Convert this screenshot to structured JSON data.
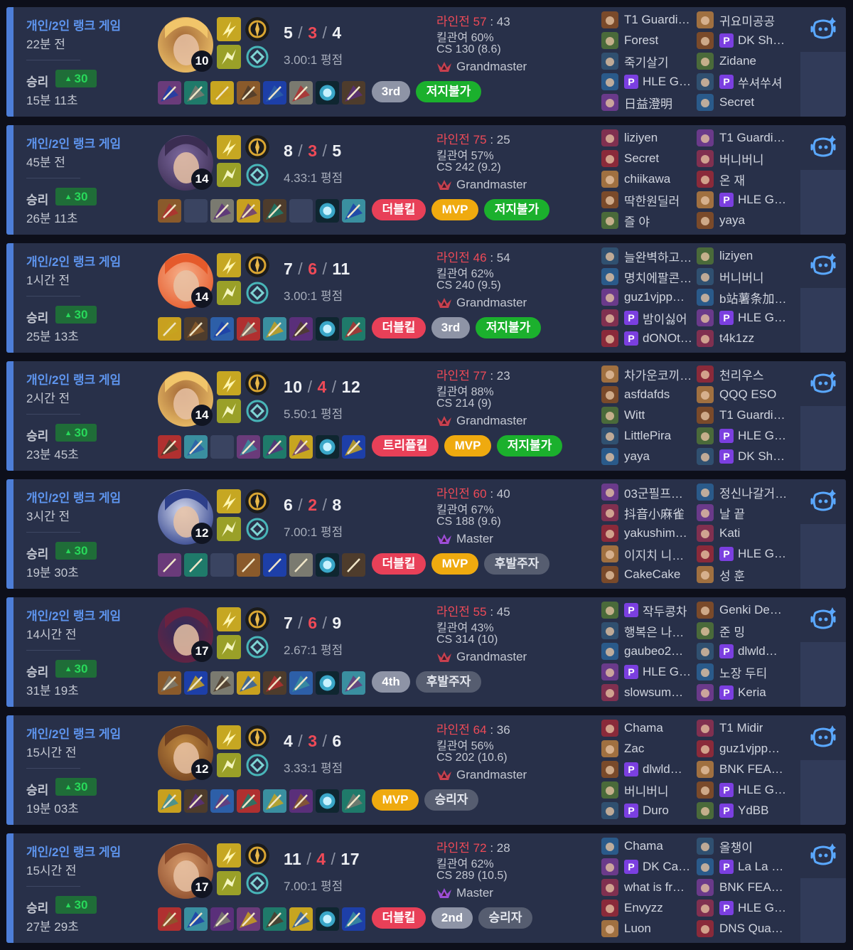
{
  "colors": {
    "card": "#283049",
    "accent": "#4d7ed8",
    "win_lp": "#28d85a",
    "red": "#ef4a57",
    "gold": "#efaa0f",
    "green": "#1bb02d"
  },
  "matches": [
    {
      "queue": "개인/2인 랭크 게임",
      "ago": "22분 전",
      "result": "승리",
      "lp": "30",
      "duration": "15분 11초",
      "level": "10",
      "champion_icon": "blonde-mage-champion-icon",
      "kda": {
        "k": "5",
        "d": "3",
        "a": "4"
      },
      "ratio": "3.00:1 평점",
      "lane": {
        "label": "라인전",
        "win": "57",
        "sep": ":",
        "loss": "43"
      },
      "kp": "킬관여 60%",
      "cs": "CS 130 (8.6)",
      "tier": "Grandmaster",
      "badges": [
        {
          "text": "3rd",
          "type": "gray"
        },
        {
          "text": "저지불가",
          "type": "green"
        }
      ],
      "items": [
        "item-1",
        "item-2",
        "item-3",
        "item-4",
        "item-5",
        "item-6",
        "item-7",
        "item-8"
      ],
      "team1": [
        {
          "name": "T1 Guardi…",
          "p": false
        },
        {
          "name": "Forest",
          "p": false
        },
        {
          "name": "죽기살기",
          "p": false
        },
        {
          "name": "HLE G…",
          "p": true
        },
        {
          "name": "日益澄明",
          "p": false
        }
      ],
      "team2": [
        {
          "name": "귀요미공공",
          "p": false
        },
        {
          "name": "DK Sh…",
          "p": true
        },
        {
          "name": "Zidane",
          "p": false
        },
        {
          "name": "쑤셔쑤셔",
          "p": true
        },
        {
          "name": "Secret",
          "p": false
        }
      ]
    },
    {
      "queue": "개인/2인 랭크 게임",
      "ago": "45분 전",
      "result": "승리",
      "lp": "30",
      "duration": "26분 11초",
      "level": "14",
      "champion_icon": "dark-hair-champion-icon",
      "kda": {
        "k": "8",
        "d": "3",
        "a": "5"
      },
      "ratio": "4.33:1 평점",
      "lane": {
        "label": "라인전",
        "win": "75",
        "sep": ":",
        "loss": "25"
      },
      "kp": "킬관여 57%",
      "cs": "CS 242 (9.2)",
      "tier": "Grandmaster",
      "badges": [
        {
          "text": "더블킬",
          "type": "red"
        },
        {
          "text": "MVP",
          "type": "gold"
        },
        {
          "text": "저지불가",
          "type": "green"
        }
      ],
      "items": [
        "item-1",
        "empty",
        "item-3",
        "item-4",
        "item-5",
        "empty",
        "item-7",
        "item-8"
      ],
      "team1": [
        {
          "name": "liziyen",
          "p": false
        },
        {
          "name": "Secret",
          "p": false
        },
        {
          "name": "chiikawa",
          "p": false
        },
        {
          "name": "딱한원딜러",
          "p": false
        },
        {
          "name": "즐 야",
          "p": false
        }
      ],
      "team2": [
        {
          "name": "T1 Guardi…",
          "p": false
        },
        {
          "name": "버니버니",
          "p": false
        },
        {
          "name": "온 재",
          "p": false
        },
        {
          "name": "HLE G…",
          "p": true
        },
        {
          "name": "yaya",
          "p": false
        }
      ]
    },
    {
      "queue": "개인/2인 랭크 게임",
      "ago": "1시간 전",
      "result": "승리",
      "lp": "30",
      "duration": "25분 13초",
      "level": "14",
      "champion_icon": "red-hair-champion-icon",
      "kda": {
        "k": "7",
        "d": "6",
        "a": "11"
      },
      "ratio": "3.00:1 평점",
      "lane": {
        "label": "라인전",
        "win": "46",
        "sep": ":",
        "loss": "54"
      },
      "kp": "킬관여 62%",
      "cs": "CS 240 (9.5)",
      "tier": "Grandmaster",
      "badges": [
        {
          "text": "더블킬",
          "type": "red"
        },
        {
          "text": "3rd",
          "type": "gray"
        },
        {
          "text": "저지불가",
          "type": "green"
        }
      ],
      "items": [
        "item-1",
        "item-2",
        "item-3",
        "item-4",
        "item-5",
        "item-6",
        "item-7",
        "item-8"
      ],
      "team1": [
        {
          "name": "늘완벽하고…",
          "p": false
        },
        {
          "name": "명치에팔콘…",
          "p": false
        },
        {
          "name": "guz1vjpp…",
          "p": false
        },
        {
          "name": "밤이싫어",
          "p": true
        },
        {
          "name": "dONOt…",
          "p": true
        }
      ],
      "team2": [
        {
          "name": "liziyen",
          "p": false
        },
        {
          "name": "버니버니",
          "p": false
        },
        {
          "name": "b站薯条加…",
          "p": false
        },
        {
          "name": "HLE G…",
          "p": true
        },
        {
          "name": "t4k1zz",
          "p": false
        }
      ]
    },
    {
      "queue": "개인/2인 랭크 게임",
      "ago": "2시간 전",
      "result": "승리",
      "lp": "30",
      "duration": "23분 45초",
      "level": "14",
      "champion_icon": "blonde-mage-champion-icon",
      "kda": {
        "k": "10",
        "d": "4",
        "a": "12"
      },
      "ratio": "5.50:1 평점",
      "lane": {
        "label": "라인전",
        "win": "77",
        "sep": ":",
        "loss": "23"
      },
      "kp": "킬관여 88%",
      "cs": "CS 214 (9)",
      "tier": "Grandmaster",
      "badges": [
        {
          "text": "트리플킬",
          "type": "red"
        },
        {
          "text": "MVP",
          "type": "gold"
        },
        {
          "text": "저지불가",
          "type": "green"
        }
      ],
      "items": [
        "item-1",
        "item-2",
        "empty",
        "item-4",
        "item-5",
        "item-6",
        "item-7",
        "item-8"
      ],
      "team1": [
        {
          "name": "차가운코끼…",
          "p": false
        },
        {
          "name": "asfdafds",
          "p": false
        },
        {
          "name": "Witt",
          "p": false
        },
        {
          "name": "LittlePira",
          "p": false
        },
        {
          "name": "yaya",
          "p": false
        }
      ],
      "team2": [
        {
          "name": "천리우스",
          "p": false
        },
        {
          "name": "QQQ ESO",
          "p": false
        },
        {
          "name": "T1 Guardi…",
          "p": false
        },
        {
          "name": "HLE G…",
          "p": true
        },
        {
          "name": "DK Sh…",
          "p": true
        }
      ]
    },
    {
      "queue": "개인/2인 랭크 게임",
      "ago": "3시간 전",
      "result": "승리",
      "lp": "30",
      "duration": "19분 30초",
      "level": "12",
      "champion_icon": "white-hair-champion-icon",
      "kda": {
        "k": "6",
        "d": "2",
        "a": "8"
      },
      "ratio": "7.00:1 평점",
      "lane": {
        "label": "라인전",
        "win": "60",
        "sep": ":",
        "loss": "40"
      },
      "kp": "킬관여 67%",
      "cs": "CS 188 (9.6)",
      "tier": "Master",
      "badges": [
        {
          "text": "더블킬",
          "type": "red"
        },
        {
          "text": "MVP",
          "type": "gold"
        },
        {
          "text": "후발주자",
          "type": "dark"
        }
      ],
      "items": [
        "item-1",
        "item-2",
        "empty",
        "item-4",
        "item-5",
        "item-6",
        "item-7",
        "item-8"
      ],
      "team1": [
        {
          "name": "03군필프…",
          "p": false
        },
        {
          "name": "抖音小麻雀",
          "p": false
        },
        {
          "name": "yakushim…",
          "p": false
        },
        {
          "name": "이지치 니…",
          "p": false
        },
        {
          "name": "CakeCake",
          "p": false
        }
      ],
      "team2": [
        {
          "name": "정신나갈거…",
          "p": false
        },
        {
          "name": "날 끝",
          "p": false
        },
        {
          "name": "Kati",
          "p": false
        },
        {
          "name": "HLE G…",
          "p": true
        },
        {
          "name": "성 훈",
          "p": false
        }
      ]
    },
    {
      "queue": "개인/2인 랭크 게임",
      "ago": "14시간 전",
      "result": "승리",
      "lp": "30",
      "duration": "31분 19초",
      "level": "17",
      "champion_icon": "horned-champion-icon",
      "kda": {
        "k": "7",
        "d": "6",
        "a": "9"
      },
      "ratio": "2.67:1 평점",
      "lane": {
        "label": "라인전",
        "win": "55",
        "sep": ":",
        "loss": "45"
      },
      "kp": "킬관여 43%",
      "cs": "CS 314 (10)",
      "tier": "Grandmaster",
      "badges": [
        {
          "text": "4th",
          "type": "gray"
        },
        {
          "text": "후발주자",
          "type": "dark"
        }
      ],
      "items": [
        "item-1",
        "item-2",
        "item-3",
        "item-4",
        "item-5",
        "item-6",
        "item-7",
        "item-8"
      ],
      "team1": [
        {
          "name": "작두콩차",
          "p": true
        },
        {
          "name": "행복은 나…",
          "p": false
        },
        {
          "name": "gaubeo2…",
          "p": false
        },
        {
          "name": "HLE G…",
          "p": true
        },
        {
          "name": "slowsum…",
          "p": false
        }
      ],
      "team2": [
        {
          "name": "Genki De…",
          "p": false
        },
        {
          "name": "준 밍",
          "p": false
        },
        {
          "name": "dlwld…",
          "p": true
        },
        {
          "name": "노장 두티",
          "p": false
        },
        {
          "name": "Keria",
          "p": true
        }
      ]
    },
    {
      "queue": "개인/2인 랭크 게임",
      "ago": "15시간 전",
      "result": "승리",
      "lp": "30",
      "duration": "19분 03초",
      "level": "12",
      "champion_icon": "robot-champion-icon",
      "kda": {
        "k": "4",
        "d": "3",
        "a": "6"
      },
      "ratio": "3.33:1 평점",
      "lane": {
        "label": "라인전",
        "win": "64",
        "sep": ":",
        "loss": "36"
      },
      "kp": "킬관여 56%",
      "cs": "CS 202 (10.6)",
      "tier": "Grandmaster",
      "badges": [
        {
          "text": "MVP",
          "type": "gold"
        },
        {
          "text": "승리자",
          "type": "dark"
        }
      ],
      "items": [
        "item-1",
        "item-2",
        "item-3",
        "item-4",
        "item-5",
        "item-6",
        "item-7",
        "item-8"
      ],
      "team1": [
        {
          "name": "Chama",
          "p": false
        },
        {
          "name": "Zac",
          "p": false
        },
        {
          "name": "dlwld…",
          "p": true
        },
        {
          "name": "버니버니",
          "p": false
        },
        {
          "name": "Duro",
          "p": true
        }
      ],
      "team2": [
        {
          "name": "T1 Midir",
          "p": false
        },
        {
          "name": "guz1vjpp…",
          "p": false
        },
        {
          "name": "BNK FEA…",
          "p": false
        },
        {
          "name": "HLE G…",
          "p": true
        },
        {
          "name": "YdBB",
          "p": true
        }
      ]
    },
    {
      "queue": "개인/2인 랭크 게임",
      "ago": "15시간 전",
      "result": "승리",
      "lp": "30",
      "duration": "27분 29초",
      "level": "17",
      "champion_icon": "bald-champion-icon",
      "kda": {
        "k": "11",
        "d": "4",
        "a": "17"
      },
      "ratio": "7.00:1 평점",
      "lane": {
        "label": "라인전",
        "win": "72",
        "sep": ":",
        "loss": "28"
      },
      "kp": "킬관여 62%",
      "cs": "CS 289 (10.5)",
      "tier": "Master",
      "badges": [
        {
          "text": "더블킬",
          "type": "red"
        },
        {
          "text": "2nd",
          "type": "gray"
        },
        {
          "text": "승리자",
          "type": "dark"
        }
      ],
      "items": [
        "item-1",
        "item-2",
        "item-3",
        "item-4",
        "item-5",
        "item-6",
        "item-7",
        "item-8"
      ],
      "team1": [
        {
          "name": "Chama",
          "p": false
        },
        {
          "name": "DK Ca…",
          "p": true
        },
        {
          "name": "what is fr…",
          "p": false
        },
        {
          "name": "Envyzz",
          "p": false
        },
        {
          "name": "Luon",
          "p": false
        }
      ],
      "team2": [
        {
          "name": "올챙이",
          "p": false
        },
        {
          "name": "La La …",
          "p": true
        },
        {
          "name": "BNK FEA…",
          "p": false
        },
        {
          "name": "HLE G…",
          "p": true
        },
        {
          "name": "DNS Qua…",
          "p": false
        }
      ]
    }
  ]
}
